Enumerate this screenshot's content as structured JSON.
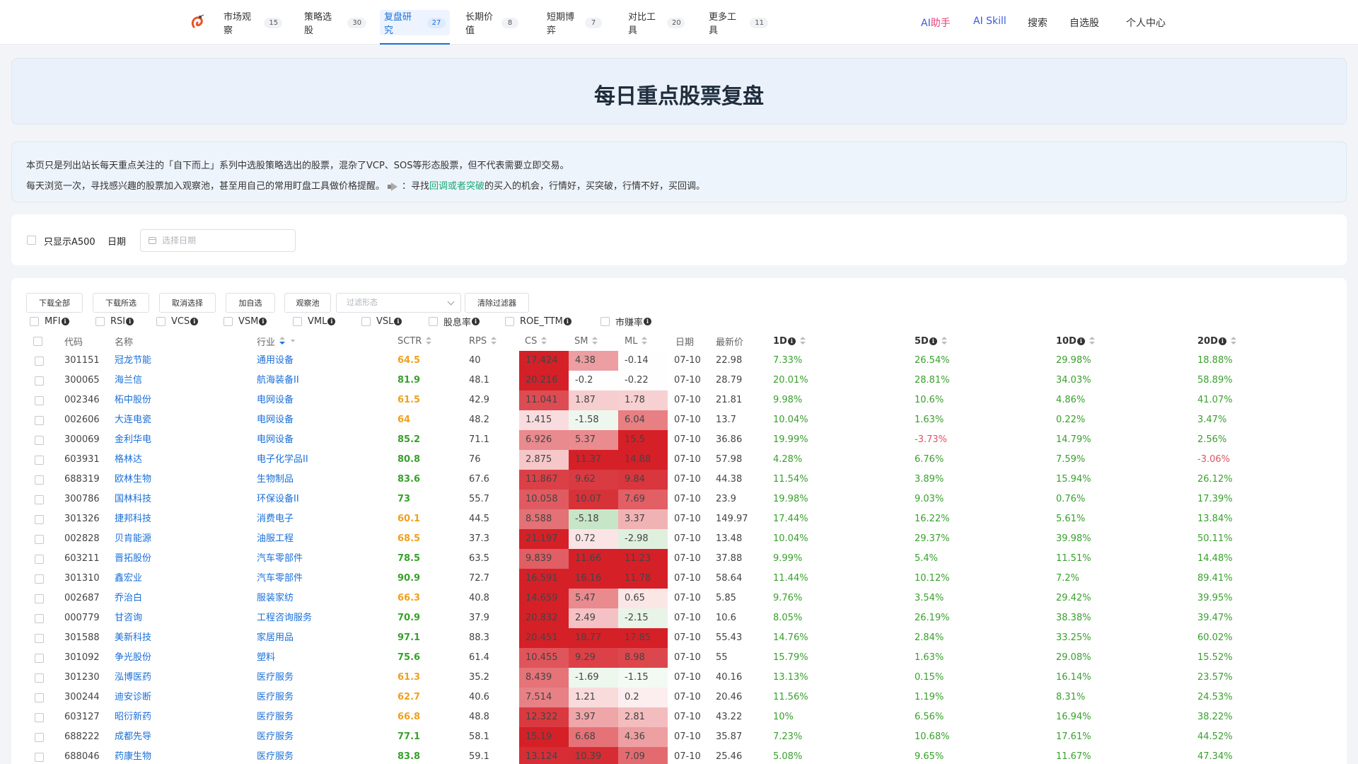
{
  "nav": {
    "logo": "logo-icon",
    "items": [
      {
        "label": "市场观察",
        "count": "15"
      },
      {
        "label": "策略选股",
        "count": "30"
      },
      {
        "label": "复盘研究",
        "count": "27"
      },
      {
        "label": "长期价值",
        "count": "8"
      },
      {
        "label": "短期博弈",
        "count": "7"
      },
      {
        "label": "对比工具",
        "count": "20"
      },
      {
        "label": "更多工具",
        "count": "11"
      }
    ],
    "ai_assistant": {
      "ai": "AI",
      "rest": "助手"
    },
    "ai_skill": "AI Skill",
    "search": "搜索",
    "watchlist": "自选股",
    "user_center": "个人中心"
  },
  "page": {
    "title": "每日重点股票复盘",
    "info_line1": "本页只是列出站长每天重点关注的「自下而上」系列中选股策略选出的股票，混杂了VCP、SOS等形态股票，但不代表需要立即交易。",
    "info_line2_a": "每天浏览一次，寻找感兴趣的股票加入观察池，甚至用自己的常用盯盘工具做价格提醒。",
    "info_line2_b": "：寻找",
    "info_line2_hl": "回调或者突破",
    "info_line2_c": "的买入的机会，行情好，买突破，行情不好，买回调。"
  },
  "filters": {
    "a500_label": "只显示A500",
    "date_label": "日期",
    "date_placeholder": "选择日期"
  },
  "toolbar": {
    "download_all": "下载全部",
    "download_selected": "下载所选",
    "deselect": "取消选择",
    "add_watch": "加自选",
    "watch_pool": "观察池",
    "pattern_placeholder": "过滤形态",
    "clear_filters": "清除过滤器"
  },
  "indicators": [
    "MFI",
    "RSI",
    "VCS",
    "VSM",
    "VML",
    "VSL",
    "股息率",
    "ROE_TTM",
    "市赚率"
  ],
  "table": {
    "headers": {
      "code": "代码",
      "name": "名称",
      "industry": "行业",
      "sctr": "SCTR",
      "rps": "RPS",
      "cs": "CS",
      "sm": "SM",
      "ml": "ML",
      "date": "日期",
      "price": "最新价",
      "d1": "1D",
      "d5": "5D",
      "d10": "10D",
      "d20": "20D"
    },
    "rows": [
      {
        "code": "301151",
        "name": "冠龙节能",
        "industry": "通用设备",
        "sctr": "64.5",
        "rps": "40",
        "cs": "17.424",
        "sm": "4.38",
        "ml": "-0.14",
        "date": "07-10",
        "price": "22.98",
        "d1": "7.33%",
        "d5": "26.54%",
        "d10": "29.98%",
        "d20": "18.88%"
      },
      {
        "code": "300065",
        "name": "海兰信",
        "industry": "航海装备II",
        "sctr": "81.9",
        "rps": "48.1",
        "cs": "20.216",
        "sm": "-0.2",
        "ml": "-0.22",
        "date": "07-10",
        "price": "28.79",
        "d1": "20.01%",
        "d5": "28.81%",
        "d10": "34.03%",
        "d20": "58.89%"
      },
      {
        "code": "002346",
        "name": "柘中股份",
        "industry": "电网设备",
        "sctr": "61.5",
        "rps": "42.9",
        "cs": "11.041",
        "sm": "1.87",
        "ml": "1.78",
        "date": "07-10",
        "price": "21.81",
        "d1": "9.98%",
        "d5": "10.6%",
        "d10": "4.86%",
        "d20": "41.07%"
      },
      {
        "code": "002606",
        "name": "大连电瓷",
        "industry": "电网设备",
        "sctr": "64",
        "rps": "48.2",
        "cs": "1.415",
        "sm": "-1.58",
        "ml": "6.04",
        "date": "07-10",
        "price": "13.7",
        "d1": "10.04%",
        "d5": "1.63%",
        "d10": "0.22%",
        "d20": "3.47%"
      },
      {
        "code": "300069",
        "name": "金利华电",
        "industry": "电网设备",
        "sctr": "85.2",
        "rps": "71.1",
        "cs": "6.926",
        "sm": "5.37",
        "ml": "15.5",
        "date": "07-10",
        "price": "36.86",
        "d1": "19.99%",
        "d5": "-3.73%",
        "d10": "14.79%",
        "d20": "2.56%"
      },
      {
        "code": "603931",
        "name": "格林达",
        "industry": "电子化学品II",
        "sctr": "80.8",
        "rps": "76",
        "cs": "2.875",
        "sm": "11.37",
        "ml": "14.88",
        "date": "07-10",
        "price": "57.98",
        "d1": "4.28%",
        "d5": "6.76%",
        "d10": "7.59%",
        "d20": "-3.06%"
      },
      {
        "code": "688319",
        "name": "欧林生物",
        "industry": "生物制品",
        "sctr": "83.6",
        "rps": "67.6",
        "cs": "11.867",
        "sm": "9.62",
        "ml": "9.84",
        "date": "07-10",
        "price": "44.38",
        "d1": "11.54%",
        "d5": "3.89%",
        "d10": "15.94%",
        "d20": "26.12%"
      },
      {
        "code": "300786",
        "name": "国林科技",
        "industry": "环保设备II",
        "sctr": "73",
        "rps": "55.7",
        "cs": "10.058",
        "sm": "10.07",
        "ml": "7.69",
        "date": "07-10",
        "price": "23.9",
        "d1": "19.98%",
        "d5": "9.03%",
        "d10": "0.76%",
        "d20": "17.39%"
      },
      {
        "code": "301326",
        "name": "捷邦科技",
        "industry": "消费电子",
        "sctr": "60.1",
        "rps": "44.5",
        "cs": "8.588",
        "sm": "-5.18",
        "ml": "3.37",
        "date": "07-10",
        "price": "149.97",
        "d1": "17.44%",
        "d5": "16.22%",
        "d10": "5.61%",
        "d20": "13.84%"
      },
      {
        "code": "002828",
        "name": "贝肯能源",
        "industry": "油服工程",
        "sctr": "68.5",
        "rps": "37.3",
        "cs": "21.197",
        "sm": "0.72",
        "ml": "-2.98",
        "date": "07-10",
        "price": "13.48",
        "d1": "10.04%",
        "d5": "29.37%",
        "d10": "39.98%",
        "d20": "50.11%"
      },
      {
        "code": "603211",
        "name": "晋拓股份",
        "industry": "汽车零部件",
        "sctr": "78.5",
        "rps": "63.5",
        "cs": "9.839",
        "sm": "11.66",
        "ml": "11.23",
        "date": "07-10",
        "price": "37.88",
        "d1": "9.99%",
        "d5": "5.4%",
        "d10": "11.51%",
        "d20": "14.48%"
      },
      {
        "code": "301310",
        "name": "鑫宏业",
        "industry": "汽车零部件",
        "sctr": "90.9",
        "rps": "72.7",
        "cs": "16.591",
        "sm": "16.16",
        "ml": "11.78",
        "date": "07-10",
        "price": "58.64",
        "d1": "11.44%",
        "d5": "10.12%",
        "d10": "7.2%",
        "d20": "89.41%"
      },
      {
        "code": "002687",
        "name": "乔治白",
        "industry": "服装家纺",
        "sctr": "66.3",
        "rps": "40.8",
        "cs": "14.659",
        "sm": "5.47",
        "ml": "0.65",
        "date": "07-10",
        "price": "5.85",
        "d1": "9.76%",
        "d5": "3.54%",
        "d10": "29.42%",
        "d20": "39.95%"
      },
      {
        "code": "000779",
        "name": "甘咨询",
        "industry": "工程咨询服务",
        "sctr": "70.9",
        "rps": "37.9",
        "cs": "20.832",
        "sm": "2.49",
        "ml": "-2.15",
        "date": "07-10",
        "price": "10.6",
        "d1": "8.05%",
        "d5": "26.19%",
        "d10": "38.38%",
        "d20": "39.47%"
      },
      {
        "code": "301588",
        "name": "美新科技",
        "industry": "家居用品",
        "sctr": "97.1",
        "rps": "88.3",
        "cs": "20.451",
        "sm": "18.77",
        "ml": "17.85",
        "date": "07-10",
        "price": "55.43",
        "d1": "14.76%",
        "d5": "2.84%",
        "d10": "33.25%",
        "d20": "60.02%"
      },
      {
        "code": "301092",
        "name": "争光股份",
        "industry": "塑料",
        "sctr": "75.6",
        "rps": "61.4",
        "cs": "10.455",
        "sm": "9.29",
        "ml": "8.98",
        "date": "07-10",
        "price": "55",
        "d1": "15.79%",
        "d5": "1.63%",
        "d10": "29.08%",
        "d20": "15.52%"
      },
      {
        "code": "301230",
        "name": "泓博医药",
        "industry": "医疗服务",
        "sctr": "61.3",
        "rps": "35.2",
        "cs": "8.439",
        "sm": "-1.69",
        "ml": "-1.15",
        "date": "07-10",
        "price": "40.16",
        "d1": "13.13%",
        "d5": "0.15%",
        "d10": "16.14%",
        "d20": "23.57%"
      },
      {
        "code": "300244",
        "name": "迪安诊断",
        "industry": "医疗服务",
        "sctr": "62.7",
        "rps": "40.6",
        "cs": "7.514",
        "sm": "1.21",
        "ml": "0.2",
        "date": "07-10",
        "price": "20.46",
        "d1": "11.56%",
        "d5": "1.19%",
        "d10": "8.31%",
        "d20": "24.53%"
      },
      {
        "code": "603127",
        "name": "昭衍新药",
        "industry": "医疗服务",
        "sctr": "66.8",
        "rps": "48.8",
        "cs": "12.322",
        "sm": "3.97",
        "ml": "2.81",
        "date": "07-10",
        "price": "43.22",
        "d1": "10%",
        "d5": "6.56%",
        "d10": "16.94%",
        "d20": "38.22%"
      },
      {
        "code": "688222",
        "name": "成都先导",
        "industry": "医疗服务",
        "sctr": "77.1",
        "rps": "58.1",
        "cs": "15.19",
        "sm": "6.68",
        "ml": "4.36",
        "date": "07-10",
        "price": "35.87",
        "d1": "7.23%",
        "d5": "10.68%",
        "d10": "17.61%",
        "d20": "44.52%"
      },
      {
        "code": "688046",
        "name": "药康生物",
        "industry": "医疗服务",
        "sctr": "83.8",
        "rps": "59.1",
        "cs": "13.124",
        "sm": "10.39",
        "ml": "7.09",
        "date": "07-10",
        "price": "25.46",
        "d1": "5.08%",
        "d5": "9.65%",
        "d10": "11.67%",
        "d20": "47.34%"
      }
    ]
  },
  "colors": {
    "accent": "#1a6fd8",
    "positive": "#3aa02e",
    "negative": "#e05263",
    "sctr_high": "#3aa02e",
    "sctr_mid": "#f0a020",
    "heat_red": "#d52128",
    "heat_green": "#bfe3bf"
  }
}
